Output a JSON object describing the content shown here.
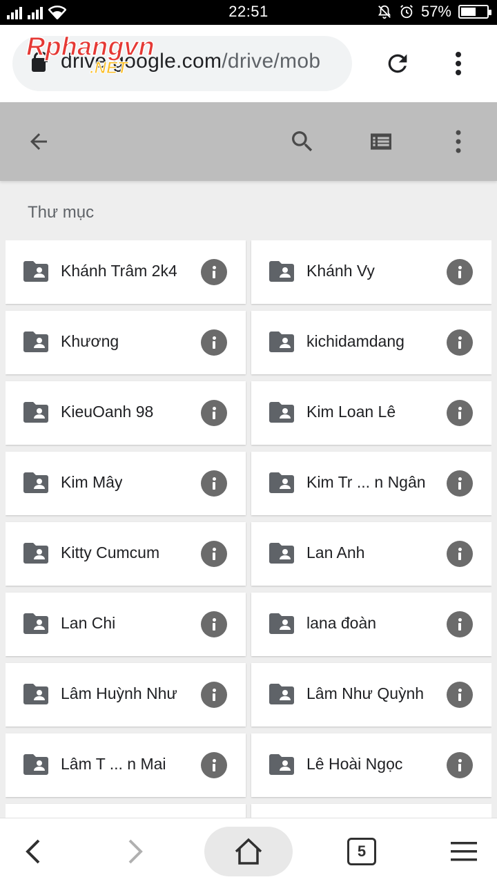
{
  "status": {
    "time": "22:51",
    "battery": "57%",
    "battery_level": 0.57
  },
  "browser": {
    "url_prefix": "drive.google.com",
    "url_suffix": "/drive/mob",
    "watermark": "Rphangvn.NET",
    "tab_count": "5",
    "icons": {
      "secure": "lock-icon",
      "reload": "reload-icon",
      "menu": "more-vert-icon"
    }
  },
  "toolbar": {
    "icons": [
      "back-arrow-icon",
      "search-icon",
      "list-view-icon",
      "more-vert-icon"
    ]
  },
  "section_title": "Thư mục",
  "folders": [
    "Khánh Trâm 2k4",
    "Khánh Vy",
    "Khương",
    "kichidamdang",
    "KieuOanh 98",
    "Kim Loan Lê",
    "Kim Mây",
    "Kim Tr ... n Ngân",
    "Kitty Cumcum",
    "Lan Anh",
    "Lan Chi",
    "lana đoàn",
    "Lâm Huỳnh Như",
    "Lâm Như Quỳnh",
    "Lâm T ... n Mai",
    "Lê Hoài Ngọc",
    "",
    ""
  ],
  "colors": {
    "toolbar": "#bdbdbd",
    "background": "#eeeeee",
    "icon": "#5f6368"
  }
}
